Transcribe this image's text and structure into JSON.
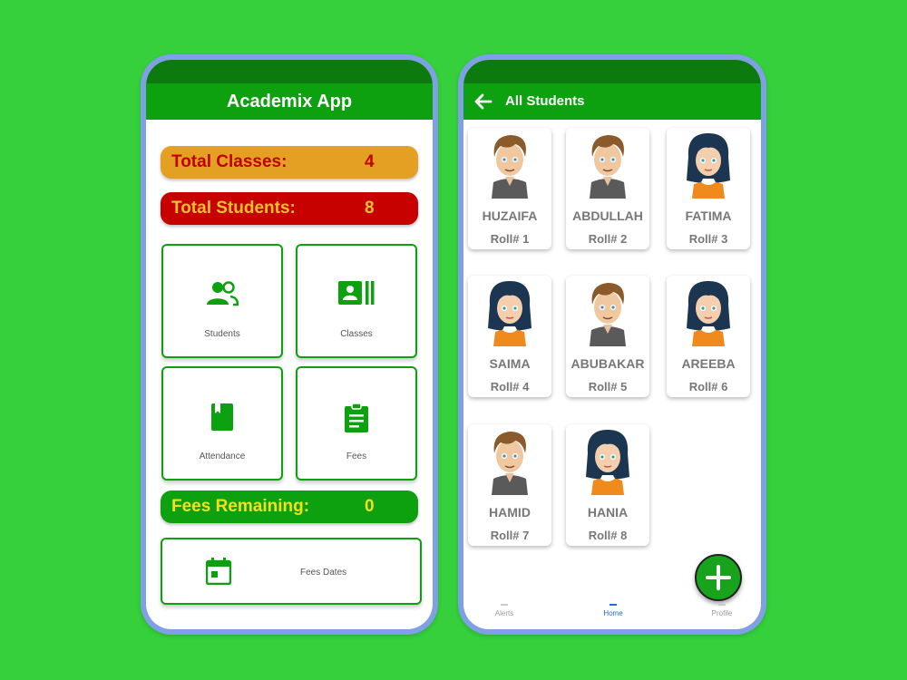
{
  "left": {
    "app_title": "Academix App",
    "total_classes": {
      "label": "Total Classes:",
      "value": "4"
    },
    "total_students": {
      "label": "Total Students:",
      "value": "8"
    },
    "tiles": {
      "students": "Students",
      "classes": "Classes",
      "attendance": "Attendance",
      "fees": "Fees"
    },
    "fees_remaining": {
      "label": "Fees Remaining:",
      "value": "0"
    },
    "fees_dates": "Fees Dates"
  },
  "right": {
    "title": "All Students",
    "students": [
      {
        "name": "HUZAIFA",
        "roll": "Roll# 1",
        "gender": "boy"
      },
      {
        "name": "ABDULLAH",
        "roll": "Roll# 2",
        "gender": "boy"
      },
      {
        "name": "FATIMA",
        "roll": "Roll# 3",
        "gender": "girl"
      },
      {
        "name": "SAIMA",
        "roll": "Roll# 4",
        "gender": "girl"
      },
      {
        "name": "ABUBAKAR",
        "roll": "Roll# 5",
        "gender": "boy"
      },
      {
        "name": "AREEBA",
        "roll": "Roll# 6",
        "gender": "girl"
      },
      {
        "name": "HAMID",
        "roll": "Roll# 7",
        "gender": "boy"
      },
      {
        "name": "HANIA",
        "roll": "Roll# 8",
        "gender": "girl"
      }
    ],
    "nav": {
      "alerts": "Alerts",
      "home": "Home",
      "profile": "Profile"
    }
  },
  "colors": {
    "background": "#35d03b",
    "primary_green": "#0ea10f",
    "dark_green": "#0c7a0f",
    "orange": "#e3a022",
    "red": "#c70000",
    "yellow": "#f6de1c"
  }
}
